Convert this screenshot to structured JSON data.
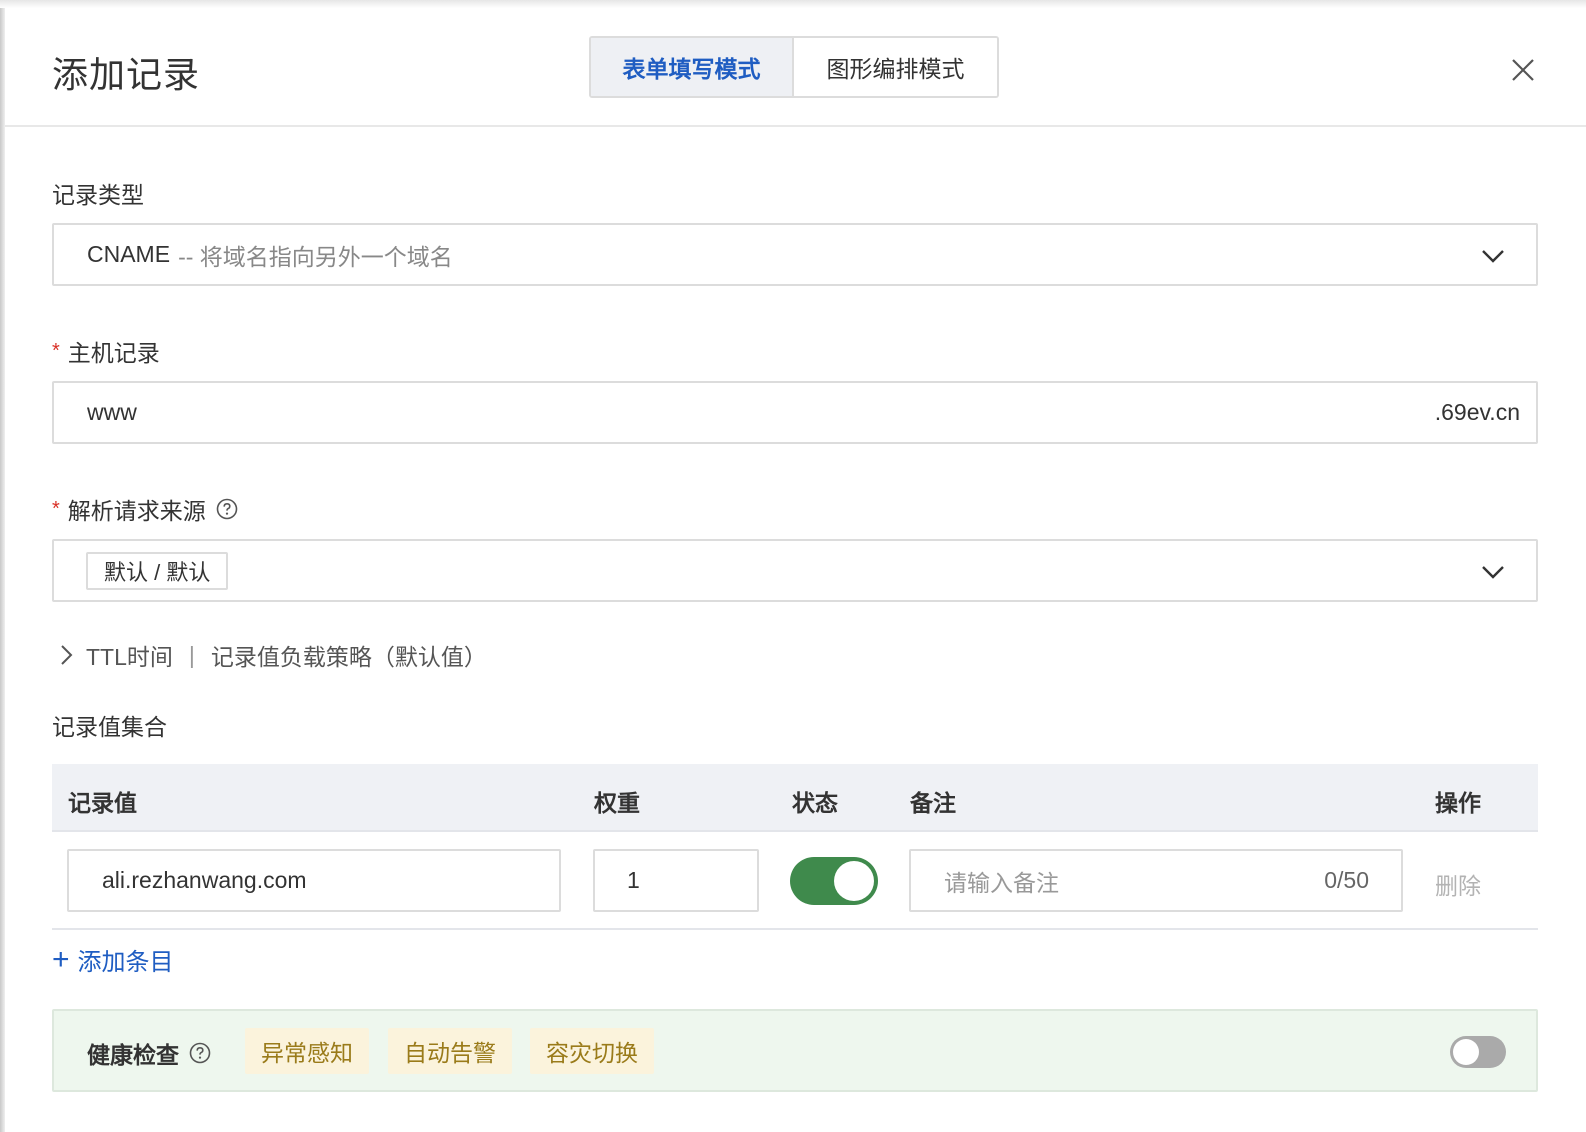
{
  "dialog": {
    "title": "添加记录",
    "tabs": [
      {
        "label": "表单填写模式",
        "active": true
      },
      {
        "label": "图形编排模式",
        "active": false
      }
    ],
    "close_icon": "close-icon"
  },
  "record_type": {
    "label": "记录类型",
    "value": "CNAME",
    "hint": "-- 将域名指向另外一个域名"
  },
  "host_record": {
    "label": "主机记录",
    "required_mark": "*",
    "value": "www",
    "suffix": ".69ev.cn"
  },
  "resolve_source": {
    "label": "解析请求来源",
    "required_mark": "*",
    "tag": "默认 / 默认"
  },
  "advanced": {
    "ttl": "TTL时间",
    "separator": "|",
    "strategy": "记录值负载策略（默认值）"
  },
  "records": {
    "label": "记录值集合",
    "columns": [
      "记录值",
      "权重",
      "状态",
      "备注",
      "操作"
    ],
    "rows": [
      {
        "value": "ali.rezhanwang.com",
        "weight": "1",
        "enabled": true,
        "remark_placeholder": "请输入备注",
        "remark_count": "0/50",
        "action": "删除"
      }
    ],
    "add_label": "添加条目",
    "add_icon": "+"
  },
  "health_check": {
    "label": "健康检查",
    "tags": [
      "异常感知",
      "自动告警",
      "容灾切换"
    ],
    "enabled": false
  },
  "colors": {
    "accent": "#1f5dc2",
    "switch_on": "#3f8a4c",
    "required": "#d93026",
    "health_bg": "#eef7ee",
    "tag_bg": "#fbf3dc"
  }
}
